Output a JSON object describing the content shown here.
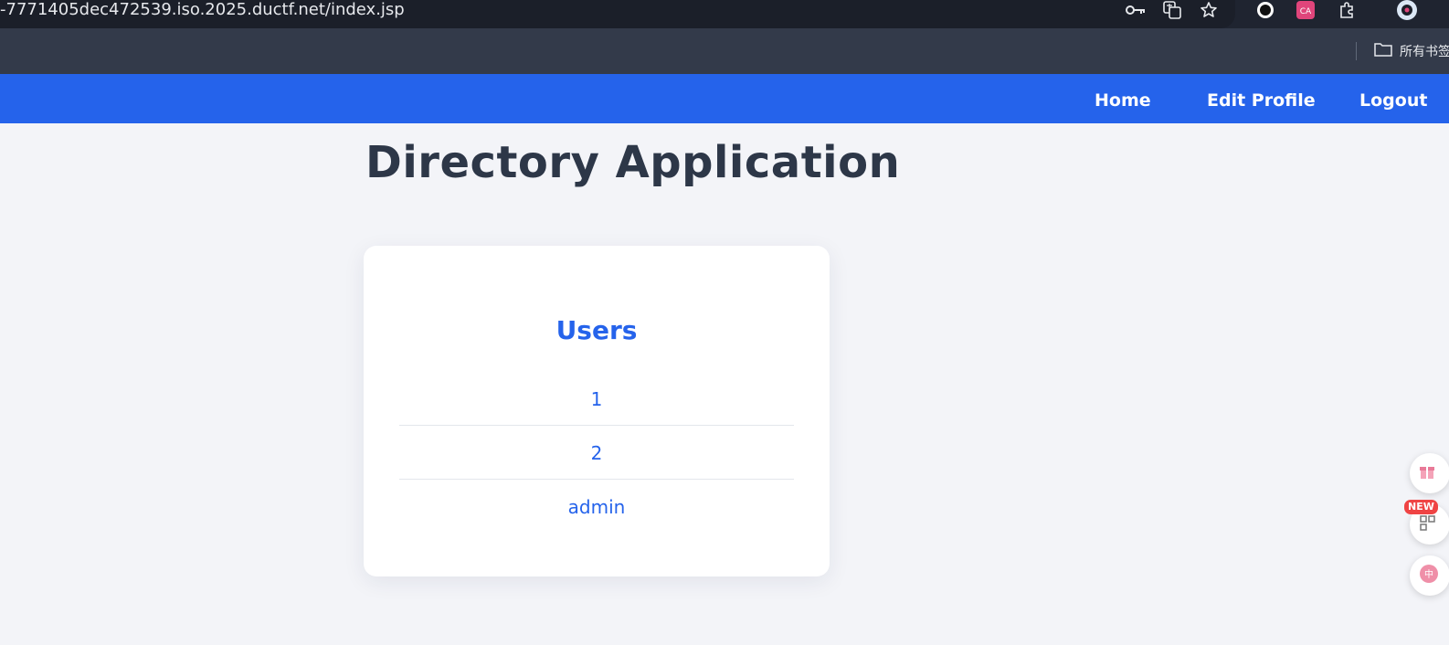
{
  "browser": {
    "url": "-7771405dec472539.iso.2025.ductf.net/index.jsp",
    "bookmark_folder_label": "所有书签"
  },
  "navbar": {
    "links": [
      "Home",
      "Edit Profile",
      "Logout"
    ]
  },
  "page": {
    "title": "Directory Application"
  },
  "users_card": {
    "heading": "Users",
    "users": [
      "1",
      "2",
      "admin"
    ]
  },
  "floating_widgets": {
    "new_badge": "NEW"
  },
  "colors": {
    "navbar": "#2563eb",
    "link": "#2563eb",
    "title": "#2d3748",
    "background": "#f3f4f8"
  }
}
